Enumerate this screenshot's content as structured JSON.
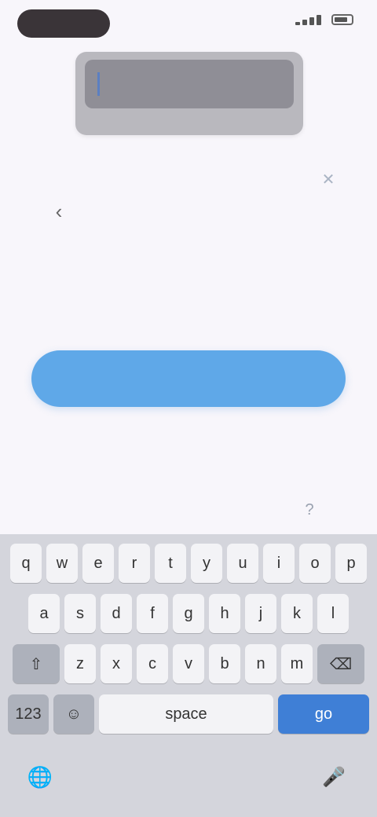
{
  "status_bar": {
    "time": "",
    "icons": [
      "signal-icon",
      "battery-icon"
    ]
  },
  "form": {
    "email_value": "",
    "clear_glyph": "✕",
    "back_glyph": "‹",
    "next_button_label": "",
    "help_glyph": "?"
  },
  "keyboard": {
    "row1": [
      "q",
      "w",
      "e",
      "r",
      "t",
      "y",
      "u",
      "i",
      "o",
      "p"
    ],
    "row2": [
      "a",
      "s",
      "d",
      "f",
      "g",
      "h",
      "j",
      "k",
      "l"
    ],
    "row3": [
      "z",
      "x",
      "c",
      "v",
      "b",
      "n",
      "m"
    ],
    "shift_glyph": "⇧",
    "delete_glyph": "⌫",
    "numbers_label": "123",
    "emoji_glyph": "☺",
    "space_label": "space",
    "go_label": "go",
    "globe_glyph": "🌐",
    "mic_glyph": "🎤"
  },
  "colors": {
    "accent": "#5fa8e8",
    "go_key": "#3f7fd6",
    "keyboard_bg": "#d4d5dc"
  }
}
